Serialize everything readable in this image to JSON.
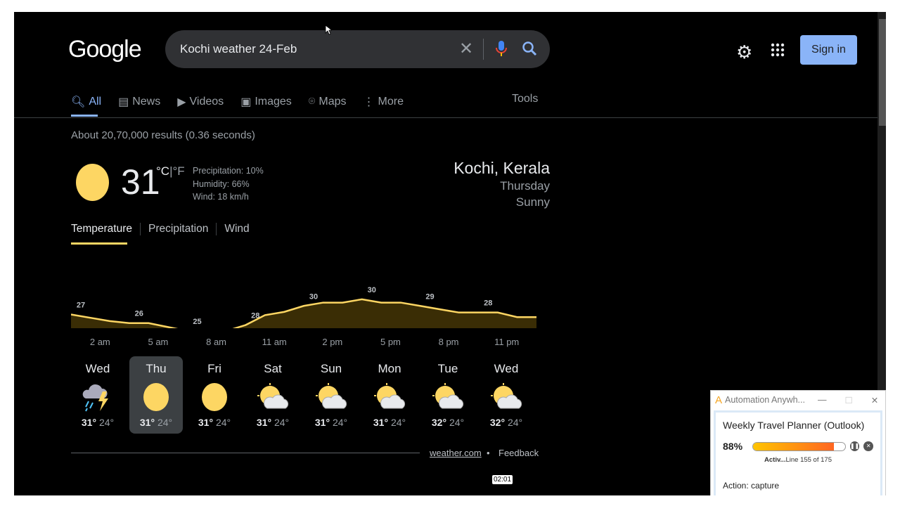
{
  "logo": "Google",
  "search": {
    "query": "Kochi weather 24-Feb"
  },
  "header": {
    "signin": "Sign in"
  },
  "tabs": [
    {
      "label": "All",
      "icon": "search-icon"
    },
    {
      "label": "News",
      "icon": "news-icon"
    },
    {
      "label": "Videos",
      "icon": "video-icon"
    },
    {
      "label": "Images",
      "icon": "image-icon"
    },
    {
      "label": "Maps",
      "icon": "map-pin-icon"
    },
    {
      "label": "More",
      "icon": "more-vert-icon"
    }
  ],
  "tools": "Tools",
  "stats": "About 20,70,000 results (0.36 seconds)",
  "weather": {
    "temp": "31",
    "unit_c": "°C",
    "unit_sep": "|",
    "unit_f": "°F",
    "precipitation": "Precipitation: 10%",
    "humidity": "Humidity: 66%",
    "wind": "Wind: 18 km/h",
    "location": "Kochi, Kerala",
    "day": "Thursday",
    "condition": "Sunny",
    "tabs": [
      "Temperature",
      "Precipitation",
      "Wind"
    ],
    "hour_labels": [
      "2 am",
      "5 am",
      "8 am",
      "11 am",
      "2 pm",
      "5 pm",
      "8 pm",
      "11 pm"
    ],
    "days": [
      {
        "name": "Wed",
        "icon": "thunderstorm-icon",
        "hi": "31°",
        "lo": "24°"
      },
      {
        "name": "Thu",
        "icon": "sun-icon",
        "hi": "31°",
        "lo": "24°"
      },
      {
        "name": "Fri",
        "icon": "sun-icon",
        "hi": "31°",
        "lo": "24°"
      },
      {
        "name": "Sat",
        "icon": "partly-cloudy-icon",
        "hi": "31°",
        "lo": "24°"
      },
      {
        "name": "Sun",
        "icon": "partly-cloudy-icon",
        "hi": "31°",
        "lo": "24°"
      },
      {
        "name": "Mon",
        "icon": "partly-cloudy-icon",
        "hi": "31°",
        "lo": "24°"
      },
      {
        "name": "Tue",
        "icon": "partly-cloudy-icon",
        "hi": "32°",
        "lo": "24°"
      },
      {
        "name": "Wed",
        "icon": "partly-cloudy-icon",
        "hi": "32°",
        "lo": "24°"
      }
    ],
    "source": "weather.com",
    "separator": "•",
    "feedback": "Feedback"
  },
  "chart_data": {
    "type": "area",
    "labels": [
      "27",
      "26",
      "25",
      "28",
      "30",
      "30",
      "29",
      "28"
    ],
    "label_values": [
      27,
      26,
      25,
      28,
      30,
      30,
      29,
      28
    ],
    "values": [
      27.5,
      27,
      26.5,
      26.2,
      26.2,
      25.6,
      25,
      25,
      25,
      25.9,
      27.4,
      27.9,
      28.8,
      29.3,
      29.3,
      29.8,
      29.3,
      29.3,
      28.8,
      28.3,
      27.8,
      27.8,
      27.8,
      27.1,
      27.1
    ],
    "line_color": "#fdd663",
    "fill_color": "#3a2d05"
  },
  "clock": "02:01",
  "automation": {
    "app_title": "Automation Anywh...",
    "task": "Weekly Travel Planner (Outlook)",
    "percent": "88%",
    "progress": 0.88,
    "status_bold": "Activ...",
    "status": "Line 155 of 175",
    "action": "Action: capture"
  }
}
